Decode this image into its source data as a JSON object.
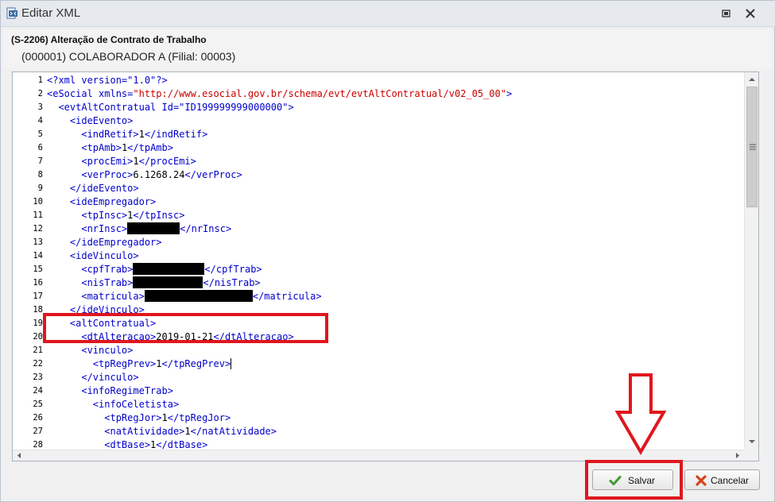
{
  "window": {
    "title": "Editar XML",
    "icons": {
      "app": "xml-file-icon",
      "restore": "restore-icon",
      "close": "close-icon"
    }
  },
  "header": {
    "event_title": "(S-2206) Alteração de Contrato de Trabalho",
    "collaborator": "(000001) COLABORADOR A (Filial: 00003)"
  },
  "editor": {
    "lines": [
      {
        "n": "1",
        "parts": [
          {
            "c": "t",
            "x": "<?xml version="
          },
          {
            "c": "t",
            "x": "\"1.0\""
          },
          {
            "c": "t",
            "x": "?>"
          }
        ]
      },
      {
        "n": "2",
        "parts": [
          {
            "c": "t",
            "x": "<eSocial xmlns="
          },
          {
            "c": "s",
            "x": "\"http://www.esocial.gov.br/schema/evt/evtAltContratual/v02_05_00\""
          },
          {
            "c": "t",
            "x": ">"
          }
        ]
      },
      {
        "n": "3",
        "parts": [
          {
            "c": "v",
            "x": "  "
          },
          {
            "c": "t",
            "x": "<evtAltContratual Id="
          },
          {
            "c": "t",
            "x": "\"ID199999999000000\""
          },
          {
            "c": "t",
            "x": ">"
          }
        ]
      },
      {
        "n": "4",
        "parts": [
          {
            "c": "v",
            "x": "    "
          },
          {
            "c": "t",
            "x": "<ideEvento>"
          }
        ]
      },
      {
        "n": "5",
        "parts": [
          {
            "c": "v",
            "x": "      "
          },
          {
            "c": "t",
            "x": "<indRetif>"
          },
          {
            "c": "v",
            "x": "1"
          },
          {
            "c": "t",
            "x": "</indRetif>"
          }
        ]
      },
      {
        "n": "6",
        "parts": [
          {
            "c": "v",
            "x": "      "
          },
          {
            "c": "t",
            "x": "<tpAmb>"
          },
          {
            "c": "v",
            "x": "1"
          },
          {
            "c": "t",
            "x": "</tpAmb>"
          }
        ]
      },
      {
        "n": "7",
        "parts": [
          {
            "c": "v",
            "x": "      "
          },
          {
            "c": "t",
            "x": "<procEmi>"
          },
          {
            "c": "v",
            "x": "1"
          },
          {
            "c": "t",
            "x": "</procEmi>"
          }
        ]
      },
      {
        "n": "8",
        "parts": [
          {
            "c": "v",
            "x": "      "
          },
          {
            "c": "t",
            "x": "<verProc>"
          },
          {
            "c": "v",
            "x": "6.1268.24"
          },
          {
            "c": "t",
            "x": "</verProc>"
          }
        ]
      },
      {
        "n": "9",
        "parts": [
          {
            "c": "v",
            "x": "    "
          },
          {
            "c": "t",
            "x": "</ideEvento>"
          }
        ]
      },
      {
        "n": "10",
        "parts": [
          {
            "c": "v",
            "x": "    "
          },
          {
            "c": "t",
            "x": "<ideEmpregador>"
          }
        ]
      },
      {
        "n": "11",
        "parts": [
          {
            "c": "v",
            "x": "      "
          },
          {
            "c": "t",
            "x": "<tpInsc>"
          },
          {
            "c": "v",
            "x": "1"
          },
          {
            "c": "t",
            "x": "</tpInsc>"
          }
        ]
      },
      {
        "n": "12",
        "parts": [
          {
            "c": "v",
            "x": "      "
          },
          {
            "c": "t",
            "x": "<nrInsc>"
          },
          {
            "c": "r",
            "w": 66
          },
          {
            "c": "t",
            "x": "</nrInsc>"
          }
        ]
      },
      {
        "n": "13",
        "parts": [
          {
            "c": "v",
            "x": "    "
          },
          {
            "c": "t",
            "x": "</ideEmpregador>"
          }
        ]
      },
      {
        "n": "14",
        "parts": [
          {
            "c": "v",
            "x": "    "
          },
          {
            "c": "t",
            "x": "<ideVinculo>"
          }
        ]
      },
      {
        "n": "15",
        "parts": [
          {
            "c": "v",
            "x": "      "
          },
          {
            "c": "t",
            "x": "<cpfTrab>"
          },
          {
            "c": "r",
            "w": 90
          },
          {
            "c": "t",
            "x": "</cpfTrab>"
          }
        ]
      },
      {
        "n": "16",
        "parts": [
          {
            "c": "v",
            "x": "      "
          },
          {
            "c": "t",
            "x": "<nisTrab>"
          },
          {
            "c": "r",
            "w": 88
          },
          {
            "c": "t",
            "x": "</nisTrab>"
          }
        ]
      },
      {
        "n": "17",
        "parts": [
          {
            "c": "v",
            "x": "      "
          },
          {
            "c": "t",
            "x": "<matricula>"
          },
          {
            "c": "r",
            "w": 136
          },
          {
            "c": "t",
            "x": "</matricula>"
          }
        ]
      },
      {
        "n": "18",
        "parts": [
          {
            "c": "v",
            "x": "    "
          },
          {
            "c": "t",
            "x": "</ideVinculo>"
          }
        ]
      },
      {
        "n": "19",
        "parts": [
          {
            "c": "v",
            "x": "    "
          },
          {
            "c": "t",
            "x": "<altContratual>"
          }
        ]
      },
      {
        "n": "20",
        "parts": [
          {
            "c": "v",
            "x": "      "
          },
          {
            "c": "t",
            "x": "<dtAlteracao>"
          },
          {
            "c": "v",
            "x": "2019-01-21"
          },
          {
            "c": "t",
            "x": "</dtAlteracao>"
          }
        ]
      },
      {
        "n": "21",
        "parts": [
          {
            "c": "v",
            "x": "      "
          },
          {
            "c": "t",
            "x": "<vinculo>"
          }
        ]
      },
      {
        "n": "22",
        "parts": [
          {
            "c": "v",
            "x": "        "
          },
          {
            "c": "t",
            "x": "<tpRegPrev>"
          },
          {
            "c": "v",
            "x": "1"
          },
          {
            "c": "t",
            "x": "</tpRegPrev>"
          },
          {
            "c": "cur"
          }
        ]
      },
      {
        "n": "23",
        "parts": [
          {
            "c": "v",
            "x": "      "
          },
          {
            "c": "t",
            "x": "</vinculo>"
          }
        ]
      },
      {
        "n": "24",
        "parts": [
          {
            "c": "v",
            "x": "      "
          },
          {
            "c": "t",
            "x": "<infoRegimeTrab>"
          }
        ]
      },
      {
        "n": "25",
        "parts": [
          {
            "c": "v",
            "x": "        "
          },
          {
            "c": "t",
            "x": "<infoCeletista>"
          }
        ]
      },
      {
        "n": "26",
        "parts": [
          {
            "c": "v",
            "x": "          "
          },
          {
            "c": "t",
            "x": "<tpRegJor>"
          },
          {
            "c": "v",
            "x": "1"
          },
          {
            "c": "t",
            "x": "</tpRegJor>"
          }
        ]
      },
      {
        "n": "27",
        "parts": [
          {
            "c": "v",
            "x": "          "
          },
          {
            "c": "t",
            "x": "<natAtividade>"
          },
          {
            "c": "v",
            "x": "1"
          },
          {
            "c": "t",
            "x": "</natAtividade>"
          }
        ]
      },
      {
        "n": "28",
        "parts": [
          {
            "c": "v",
            "x": "          "
          },
          {
            "c": "t",
            "x": "<dtBase>"
          },
          {
            "c": "v",
            "x": "1"
          },
          {
            "c": "t",
            "x": "</dtBase>"
          }
        ]
      }
    ]
  },
  "footer": {
    "save_label": "Salvar",
    "cancel_label": "Cancelar",
    "save_icon": "checkmark-icon",
    "cancel_icon": "x-icon"
  },
  "colors": {
    "tag": "#0000cc",
    "string": "#cc0000",
    "annotation": "#e0161e"
  }
}
